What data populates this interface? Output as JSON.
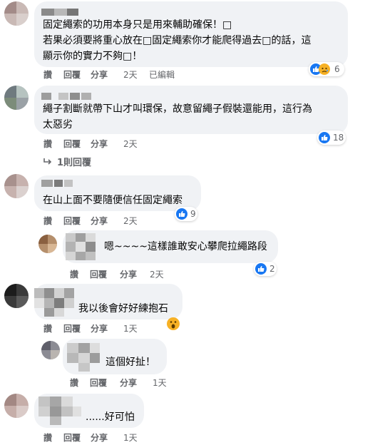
{
  "comments": [
    {
      "text_lines": [
        "固定繩索的功用本身只是用來輔助確保！□",
        "若果必須要將重心放在□固定繩索你才能爬得過去□的話，這",
        "顯示你的實力不夠□！"
      ],
      "actions": {
        "like": "讚",
        "reply": "回覆",
        "share": "分享",
        "time": "2天",
        "edited": "已編輯"
      },
      "reaction_count": "6",
      "reaction_icons": [
        "like-icon",
        "sad-icon"
      ]
    },
    {
      "text_lines": [
        "繩子割斷就帶下山才叫環保，故意留繩子假裝還能用，這行為",
        "太惡劣"
      ],
      "actions": {
        "like": "讚",
        "reply": "回覆",
        "share": "分享",
        "time": "2天"
      },
      "reaction_count": "18",
      "replies_label": "1則回覆"
    },
    {
      "text_lines": [
        "在山上面不要隨便信任固定繩索"
      ],
      "actions": {
        "like": "讚",
        "reply": "回覆",
        "share": "分享",
        "time": "2天"
      },
      "reaction_count": "9"
    },
    {
      "text_lines": [
        "嗯~~~~這樣誰敢安心攀爬拉繩路段"
      ],
      "actions": {
        "like": "讚",
        "reply": "回覆",
        "share": "分享",
        "time": "2天"
      },
      "reaction_count": "2"
    },
    {
      "text_lines": [
        "我以後會好好練抱石"
      ],
      "actions": {
        "like": "讚",
        "reply": "回覆",
        "share": "分享",
        "time": "1天"
      },
      "reaction_icons": [
        "wow-icon"
      ]
    },
    {
      "text_lines": [
        "這個好扯！"
      ],
      "actions": {
        "like": "讚",
        "reply": "回覆",
        "share": "分享",
        "time": "1天"
      }
    },
    {
      "text_lines": [
        "......好可怕"
      ],
      "actions": {
        "like": "讚",
        "reply": "回覆",
        "share": "分享",
        "time": "1天"
      }
    }
  ],
  "colors": {
    "bubble": "#f0f2f5",
    "like": "#1877f2",
    "secondary_text": "#65676b"
  }
}
